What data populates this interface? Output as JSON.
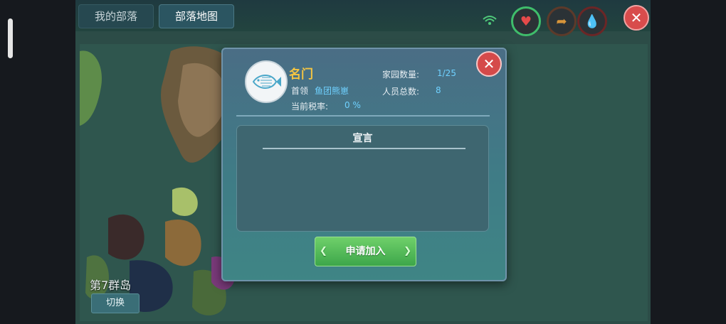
{
  "tabs": [
    {
      "label": "我的部落",
      "active": false
    },
    {
      "label": "部落地图",
      "active": true
    }
  ],
  "map": {
    "island_label": "第7群岛",
    "switch_label": "切换"
  },
  "dialog": {
    "tribe_name": "名门",
    "leader_label": "首领",
    "leader_value": "鱼团熊崽",
    "tax_label": "当前税率:",
    "tax_value": "0 %",
    "homes_label": "家园数量:",
    "homes_value": "1/25",
    "members_label": "人员总数:",
    "members_value": "8",
    "declaration_title": "宣言",
    "apply_label": "申请加入"
  },
  "status_icons": [
    "wifi-icon",
    "heart-icon",
    "arrow-icon",
    "water-drop-icon",
    "close-icon"
  ],
  "colors": {
    "accent_gold": "#f5c542",
    "value_blue": "#6fd1ff",
    "button_green": "#3da64a",
    "close_red": "#d54a4a"
  }
}
